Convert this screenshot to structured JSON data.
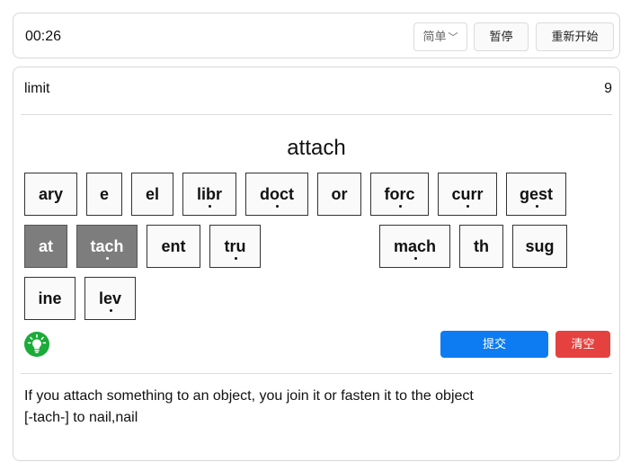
{
  "toolbar": {
    "timer": "00:26",
    "level_select": "简单",
    "pause_label": "暂停",
    "restart_label": "重新开始"
  },
  "quiz": {
    "word": "limit",
    "count": "9",
    "target": "attach",
    "tiles": [
      {
        "text": "ary",
        "dotted": false,
        "selected": false
      },
      {
        "text": "e",
        "dotted": false,
        "selected": false
      },
      {
        "text": "el",
        "dotted": false,
        "selected": false
      },
      {
        "text": "libr",
        "dotted": true,
        "selected": false
      },
      {
        "text": "doct",
        "dotted": true,
        "selected": false
      },
      {
        "text": "or",
        "dotted": false,
        "selected": false
      },
      {
        "text": "forc",
        "dotted": true,
        "selected": false
      },
      {
        "text": "curr",
        "dotted": true,
        "selected": false
      },
      {
        "text": "gest",
        "dotted": true,
        "selected": false
      },
      {
        "text": "at",
        "dotted": false,
        "selected": true
      },
      {
        "text": "tach",
        "dotted": true,
        "selected": true
      },
      {
        "text": "ent",
        "dotted": false,
        "selected": false
      },
      {
        "text": "tru",
        "dotted": true,
        "selected": false
      },
      {
        "text": "mach",
        "dotted": true,
        "selected": false
      },
      {
        "text": "th",
        "dotted": false,
        "selected": false
      },
      {
        "text": "sug",
        "dotted": false,
        "selected": false
      },
      {
        "text": "ine",
        "dotted": false,
        "selected": false
      },
      {
        "text": "lev",
        "dotted": true,
        "selected": false
      }
    ],
    "hint_icon": "lightbulb-icon",
    "submit_label": "提交",
    "clear_label": "清空",
    "definition_line1": "If you attach something to an object, you join it or fasten it to the object",
    "definition_line2": "[-tach-] to nail,nail"
  },
  "colors": {
    "selected_tile": "#7d7d7d",
    "submit": "#0d7cf2",
    "clear": "#e5423f",
    "hint": "#1aab39"
  }
}
